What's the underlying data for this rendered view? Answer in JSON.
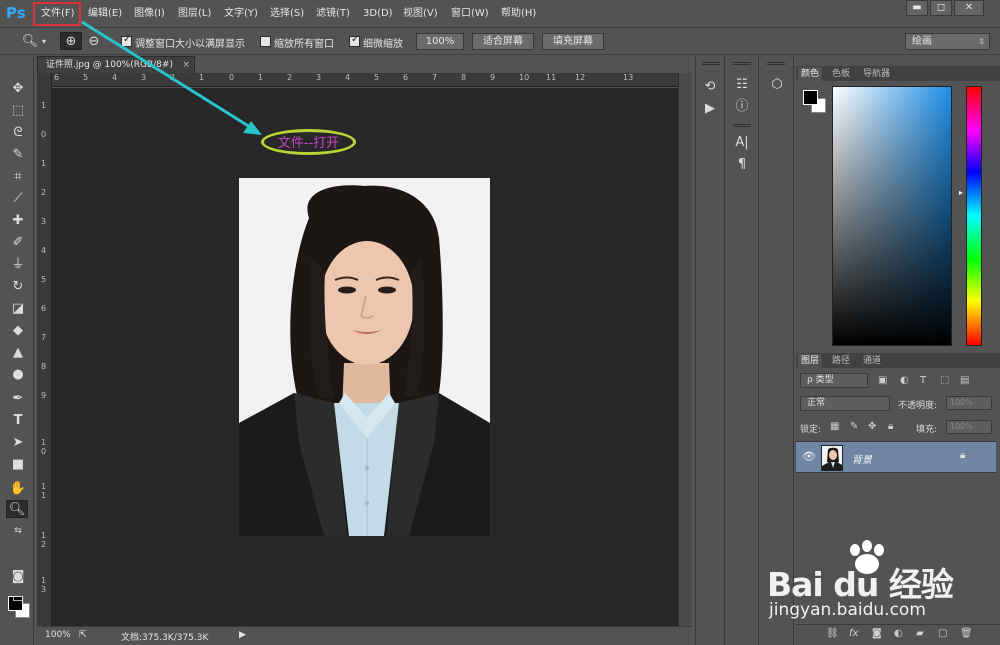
{
  "app": {
    "logo": "Ps"
  },
  "menu": {
    "items": [
      "文件(F)",
      "编辑(E)",
      "图像(I)",
      "图层(L)",
      "文字(Y)",
      "选择(S)",
      "滤镜(T)",
      "3D(D)",
      "视图(V)",
      "窗口(W)",
      "帮助(H)"
    ]
  },
  "window_controls": {
    "minimize": "▬",
    "restore": "◻",
    "close": "✕"
  },
  "options": {
    "resize_windows_label": "调整窗口大小以满屏显示",
    "zoom_all_label": "缩放所有窗口",
    "scrubby_zoom_label": "细微缩放",
    "btn_100": "100%",
    "btn_fit": "适合屏幕",
    "btn_fill": "填充屏幕",
    "workspace_value": "绘画"
  },
  "document": {
    "tab_title": "证件照.jpg @ 100%(RGB/8#)",
    "tab_close": "×",
    "ruler_h": [
      "6",
      "5",
      "4",
      "3",
      "2",
      "1",
      "0",
      "1",
      "2",
      "3",
      "4",
      "5",
      "6",
      "7",
      "8",
      "9",
      "10",
      "11",
      "12",
      "13"
    ],
    "ruler_v": [
      "1",
      "0",
      "1",
      "2",
      "3",
      "4",
      "5",
      "6",
      "7",
      "8",
      "9",
      "1 0",
      "1 1",
      "1 2",
      "1 3"
    ],
    "annotation": "文件--打开"
  },
  "status": {
    "zoom": "100%",
    "doc_info": "文档:375.3K/375.3K",
    "arrow": "▶"
  },
  "color_panel": {
    "tabs": [
      "颜色",
      "色板",
      "导航器"
    ]
  },
  "layers_panel": {
    "tabs": [
      "图层",
      "路径",
      "通道"
    ],
    "filter_kind": "ρ 类型",
    "blend_mode": "正常",
    "opacity_label": "不透明度:",
    "opacity_value": "100%",
    "lock_label": "锁定:",
    "fill_label": "填充:",
    "fill_value": "100%",
    "layer_name": "背景"
  },
  "watermark": {
    "brand": "Bai du 经验",
    "url": "jingyan.baidu.com"
  },
  "colors": {
    "accent": "#31a8ff",
    "highlight_box": "#e0303a",
    "arrow": "#27c4cc",
    "oval": "#b7d335",
    "annotation_text": "#c840c8",
    "selected_layer": "#6f86a5"
  }
}
